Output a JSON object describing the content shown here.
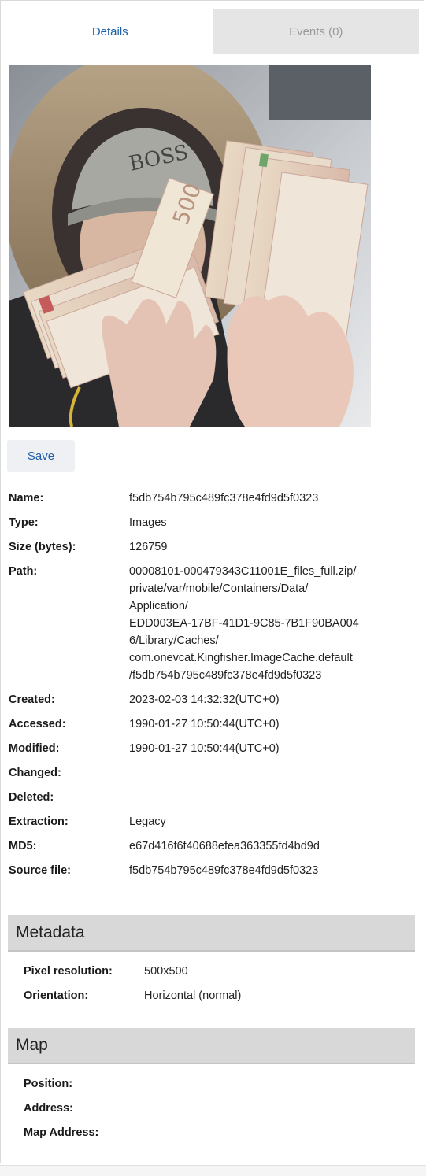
{
  "tabs": [
    {
      "label": "Details"
    },
    {
      "label": "Events (0)"
    }
  ],
  "save_label": "Save",
  "properties": [
    {
      "key": "Name:",
      "value": "f5db754b795c489fc378e4fd9d5f0323"
    },
    {
      "key": "Type:",
      "value": "Images"
    },
    {
      "key": "Size (bytes):",
      "value": "126759"
    },
    {
      "key": "Path:",
      "value": "00008101-000479343C11001E_files_full.zip/\nprivate/var/mobile/Containers/Data/\nApplication/\nEDD003EA-17BF-41D1-9C85-7B1F90BA004\n6/Library/Caches/\ncom.onevcat.Kingfisher.ImageCache.default\n/f5db754b795c489fc378e4fd9d5f0323"
    },
    {
      "key": "Created:",
      "value": "2023-02-03 14:32:32(UTC+0)"
    },
    {
      "key": "Accessed:",
      "value": "1990-01-27 10:50:44(UTC+0)"
    },
    {
      "key": "Modified:",
      "value": "1990-01-27 10:50:44(UTC+0)"
    },
    {
      "key": "Changed:",
      "value": ""
    },
    {
      "key": "Deleted:",
      "value": ""
    },
    {
      "key": "Extraction:",
      "value": "Legacy"
    },
    {
      "key": "MD5:",
      "value": "e67d416f6f40688efea363355fd4bd9d"
    },
    {
      "key": "Source file:",
      "value": "f5db754b795c489fc378e4fd9d5f0323"
    }
  ],
  "metadata": {
    "title": "Metadata",
    "rows": [
      {
        "key": "Pixel resolution:",
        "value": "500x500"
      },
      {
        "key": "Orientation:",
        "value": "Horizontal (normal)"
      }
    ]
  },
  "map": {
    "title": "Map",
    "rows": [
      {
        "key": "Position:",
        "value": ""
      },
      {
        "key": "Address:",
        "value": ""
      },
      {
        "key": "Map Address:",
        "value": ""
      }
    ]
  },
  "photo_text": "500"
}
